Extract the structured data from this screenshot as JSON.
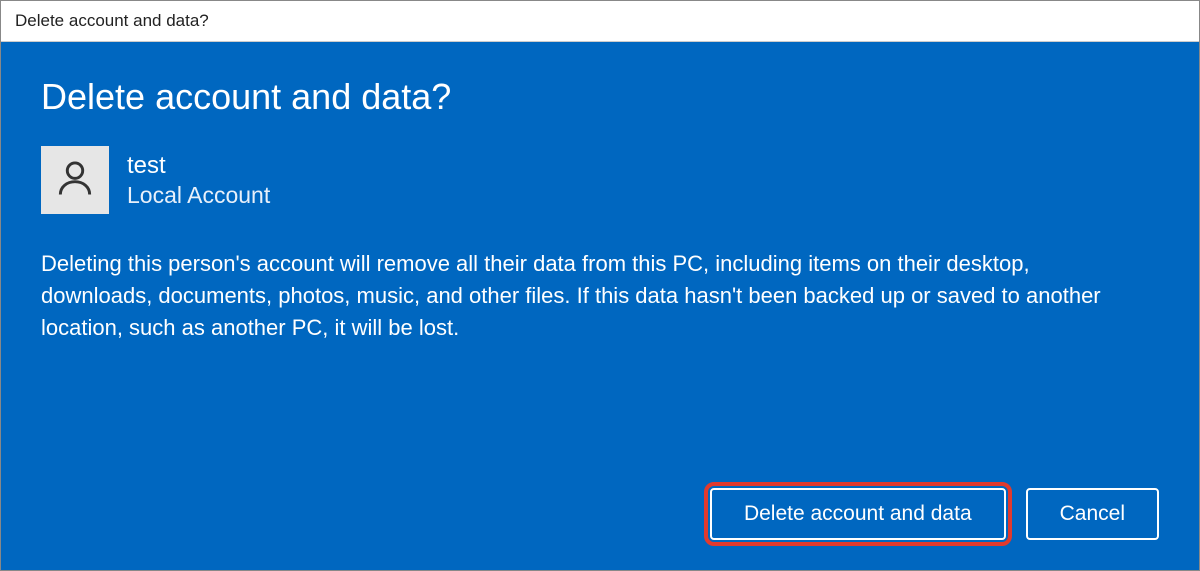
{
  "window": {
    "title": "Delete account and data?"
  },
  "dialog": {
    "heading": "Delete account and data?",
    "user": {
      "name": "test",
      "account_type": "Local Account"
    },
    "description": "Deleting this person's account will remove all their data from this PC, including items on their desktop, downloads, documents, photos, music, and other files. If this data hasn't been backed up or saved to another location, such as another PC, it will be lost.",
    "buttons": {
      "confirm": "Delete account and data",
      "cancel": "Cancel"
    }
  }
}
